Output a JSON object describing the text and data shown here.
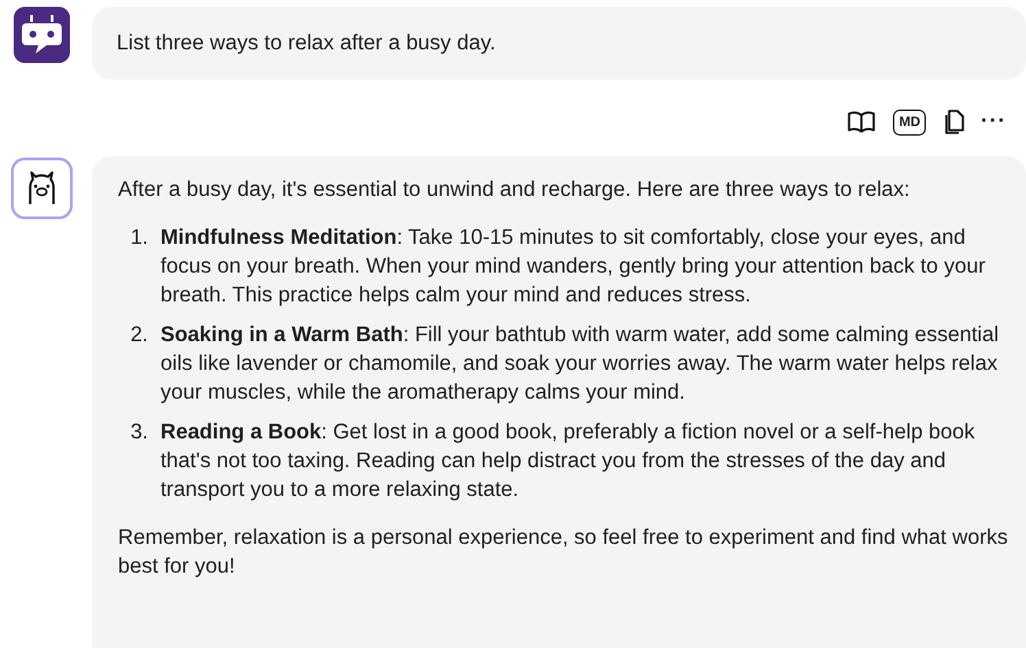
{
  "user_message": {
    "text": "List three ways to relax after a busy day."
  },
  "toolbar": {
    "md_label": "MD",
    "more": "···"
  },
  "response": {
    "intro": "After a busy day, it's essential to unwind and recharge. Here are three ways to relax:",
    "items": [
      {
        "number": "1.",
        "title": "Mindfulness Meditation",
        "text": ": Take 10-15 minutes to sit comfortably, close your eyes, and focus on your breath. When your mind wanders, gently bring your attention back to your breath. This practice helps calm your mind and reduces stress."
      },
      {
        "number": "2.",
        "title": "Soaking in a Warm Bath",
        "text": ": Fill your bathtub with warm water, add some calming essential oils like lavender or chamomile, and soak your worries away. The warm water helps relax your muscles, while the aromatherapy calms your mind."
      },
      {
        "number": "3.",
        "title": "Reading a Book",
        "text": ": Get lost in a good book, preferably a fiction novel or a self-help book that's not too taxing. Reading can help distract you from the stresses of the day and transport you to a more relaxing state."
      }
    ],
    "outro": "Remember, relaxation is a personal experience, so feel free to experiment and find what works best for you!"
  }
}
